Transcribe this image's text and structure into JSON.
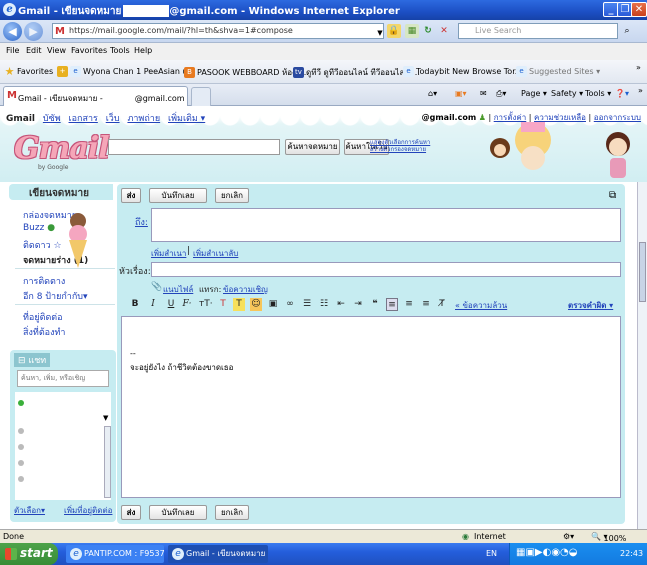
{
  "window": {
    "title_prefix": "Gmail - เขียนจดหมาย",
    "title_suffix": "@gmail.com - Windows Internet Explorer"
  },
  "addressbar": {
    "url": "https://mail.google.com/mail/?hl=th&shva=1#compose",
    "search_placeholder": "Live Search"
  },
  "menubar": [
    "File",
    "Edit",
    "View",
    "Favorites",
    "Tools",
    "Help"
  ],
  "favorites": {
    "label": "Favorites",
    "items": [
      "Wyona Chan 1 PeeAsian u...",
      "PASOOK WEBBOARD ห้องเ...",
      "ดูทีวี ดูทีวีออนไลน์ ทีวีออนไลน์ ...",
      "Todaybit New Browse Tor...",
      "Suggested Sites ▾"
    ]
  },
  "tabbar": {
    "tab_title_prefix": "Gmail - เขียนจดหมาย -",
    "tab_title_suffix": "@gmail.com",
    "commands": [
      "Page ▾",
      "Safety ▾",
      "Tools ▾"
    ]
  },
  "gmail": {
    "topnav": [
      "บัซัพ",
      "เอกสาร",
      "เว็บ",
      "ภาพถ่าย",
      "เพิ่มเติม ▾"
    ],
    "topnav_active": "Gmail",
    "account": "@gmail.com",
    "rightnav": [
      "การตั้งค่า",
      "ความช่วยเหลือ",
      "ออกจากระบบ"
    ],
    "logo": "Gmail",
    "logo_sub": "by Google",
    "search_mail_button": "ค้นหาจดหมาย",
    "search_web_button": "ค้นหาในเว็บ",
    "search_options_1": "แสดงตัวเลือกการค้นหา",
    "search_options_2": "สร้างตัวกรองจดหมาย",
    "leftnav": {
      "compose": "เขียนจดหมาย",
      "inbox": "กล่องจดหมาย",
      "buzz": "Buzz",
      "starred": "ติดดาว ☆",
      "drafts": "จดหมายร่าง (1)",
      "contacts": "การติดตาง",
      "more_labels": "อีก 8 ป้ายกำกับ▾",
      "addresses": "ที่อยู่ติดต่อ",
      "tasks": "สิ่งที่ต้องทำ"
    },
    "chat": {
      "header": "⊟ แชท",
      "search_placeholder": "ค้นหา, เพิ่ม, หรือเชิญ",
      "options_link": "ตัวเลือก▾",
      "add_contact_link": "เพิ่มที่อยู่ติดต่อ"
    },
    "compose": {
      "send": "ส่ง",
      "save": "บันทึกเลย",
      "discard": "ยกเลิก",
      "to_label": "ถึง:",
      "add_cc": "เพิ่มสำเนา",
      "add_bcc": "เพิ่มสำเนาลับ",
      "subject_label": "หัวเรื่อง:",
      "attach_file": "แนบไฟล์",
      "insert_text": "แทรก:",
      "invitation": "ข้อความเชิญ",
      "plain_text": "« ข้อความล้วน",
      "spellcheck": "ตรวจคำผิด ▾",
      "body_line1": "--",
      "body_line2": "จะอยู่ยังไง ถ้าชีวิตต้องขาดเธอ"
    }
  },
  "statusbar": {
    "left": "Done",
    "zone": "Internet",
    "zoom": "100%"
  },
  "taskbar": {
    "start": "start",
    "task1": "PANTIP.COM : F9537...",
    "task2": "Gmail - เขียนจดหมาย -...",
    "lang": "EN",
    "time": "22:43"
  },
  "colors": {
    "titlebar": "#1c4fc4",
    "gmail_header": "#d1eef2",
    "panel": "#c6ecf1",
    "link": "#2244bb",
    "start_button": "#388c35"
  }
}
